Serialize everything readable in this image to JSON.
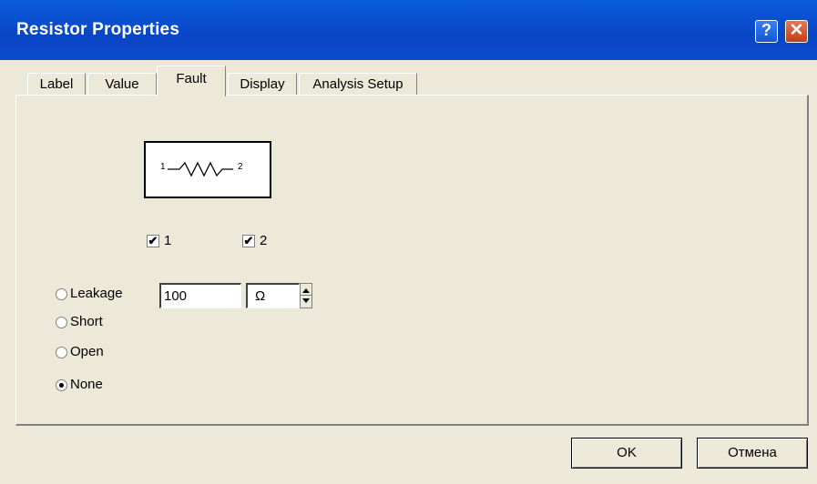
{
  "window": {
    "title": "Resistor Properties"
  },
  "titlebar": {
    "help_glyph": "?",
    "close_glyph": "✕"
  },
  "tabs": [
    {
      "label": "Label",
      "active": false
    },
    {
      "label": "Value",
      "active": false
    },
    {
      "label": "Fault",
      "active": true
    },
    {
      "label": "Display",
      "active": false
    },
    {
      "label": "Analysis Setup",
      "active": false
    }
  ],
  "symbol": {
    "pin1": "1",
    "pin2": "2"
  },
  "pins": [
    {
      "label": "1",
      "checked": true
    },
    {
      "label": "2",
      "checked": true
    }
  ],
  "fault_options": [
    {
      "label": "Leakage",
      "selected": false
    },
    {
      "label": "Short",
      "selected": false
    },
    {
      "label": "Open",
      "selected": false
    },
    {
      "label": "None",
      "selected": true
    }
  ],
  "leakage": {
    "value": "100",
    "unit": "Ω"
  },
  "buttons": {
    "ok": "OK",
    "cancel": "Отмена"
  }
}
